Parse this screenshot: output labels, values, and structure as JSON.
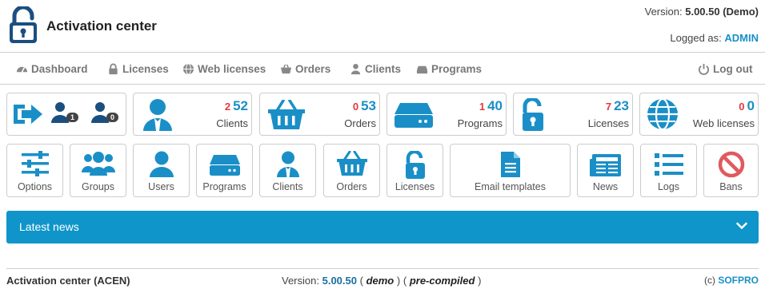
{
  "app": {
    "title": "Activation center",
    "version_label": "Version:",
    "version_value": "5.00.50 (Demo)",
    "logged_label": "Logged as:",
    "logged_user": "ADMIN"
  },
  "nav": {
    "items": [
      {
        "label": "Dashboard",
        "icon": "dashboard-icon"
      },
      {
        "label": "Licenses",
        "icon": "lock-icon"
      },
      {
        "label": "Web licenses",
        "icon": "globe-icon"
      },
      {
        "label": "Orders",
        "icon": "basket-icon"
      },
      {
        "label": "Clients",
        "icon": "user-icon"
      },
      {
        "label": "Programs",
        "icon": "drive-icon"
      }
    ],
    "logout": "Log out"
  },
  "stats": {
    "session": {
      "badge1": "1",
      "badge2": "0"
    },
    "cards": [
      {
        "label": "Clients",
        "red": "2",
        "blue": "52",
        "icon": "client-icon"
      },
      {
        "label": "Orders",
        "red": "0",
        "blue": "53",
        "icon": "basket-icon"
      },
      {
        "label": "Programs",
        "red": "1",
        "blue": "40",
        "icon": "drive-icon"
      },
      {
        "label": "Licenses",
        "red": "7",
        "blue": "23",
        "icon": "unlock-icon"
      },
      {
        "label": "Web licenses",
        "red": "0",
        "blue": "0",
        "icon": "globe-icon"
      }
    ]
  },
  "tiles": [
    {
      "label": "Options",
      "icon": "sliders-icon"
    },
    {
      "label": "Groups",
      "icon": "group-icon"
    },
    {
      "label": "Users",
      "icon": "user-icon"
    },
    {
      "label": "Programs",
      "icon": "drive-icon"
    },
    {
      "label": "Clients",
      "icon": "client-icon"
    },
    {
      "label": "Orders",
      "icon": "basket-icon"
    },
    {
      "label": "Licenses",
      "icon": "unlock-icon"
    },
    {
      "label": "Email templates",
      "icon": "document-icon"
    },
    {
      "label": "News",
      "icon": "newspaper-icon"
    },
    {
      "label": "Logs",
      "icon": "list-icon"
    },
    {
      "label": "Bans",
      "icon": "ban-icon"
    }
  ],
  "news": {
    "title": "Latest news"
  },
  "footer": {
    "left": "Activation center (ACEN)",
    "version_label": "Version:",
    "version": "5.00.50",
    "open1": "(",
    "demo": "demo",
    "close1": ")",
    "open2": "(",
    "precompiled": "pre-compiled",
    "close2": ")",
    "copy": "(c)",
    "company": "SOFPRO"
  },
  "colors": {
    "accent": "#1a8fc7",
    "red": "#e0393e",
    "banner": "#0f95c9",
    "icon": "#1a8fc7"
  }
}
